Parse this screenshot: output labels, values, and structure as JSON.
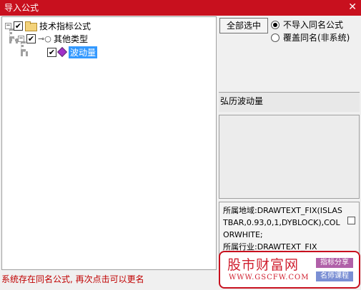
{
  "window": {
    "title": "导入公式",
    "close_glyph": "✕"
  },
  "tree": {
    "root_label": "技术指标公式",
    "child_label": "其他类型",
    "leaf_label": "波动量",
    "expander_glyph": "−"
  },
  "options": {
    "select_all_label": "全部选中",
    "radio_skip_label": "不导入同名公式",
    "radio_overwrite_label": "覆盖同名(非系统)",
    "selected_radio": "skip"
  },
  "formula_name": "弘历波动量",
  "code_text": "所属地域:DRAWTEXT_FIX(ISLASTBAR,0.93,0,1,DYBLOCK),COLORWHITE;\n所属行业:DRAWTEXT_FIX",
  "status_text": "系统存在同名公式, 再次点击可以更名",
  "watermark": {
    "logo_text": "股市财富网",
    "url_text": "WWW.GSCFW.COM",
    "tag1": "指标分享",
    "tag2": "名师课程"
  },
  "colors": {
    "title_bar": "#c8101e",
    "selection": "#3399ff",
    "status_text": "#c00000"
  }
}
